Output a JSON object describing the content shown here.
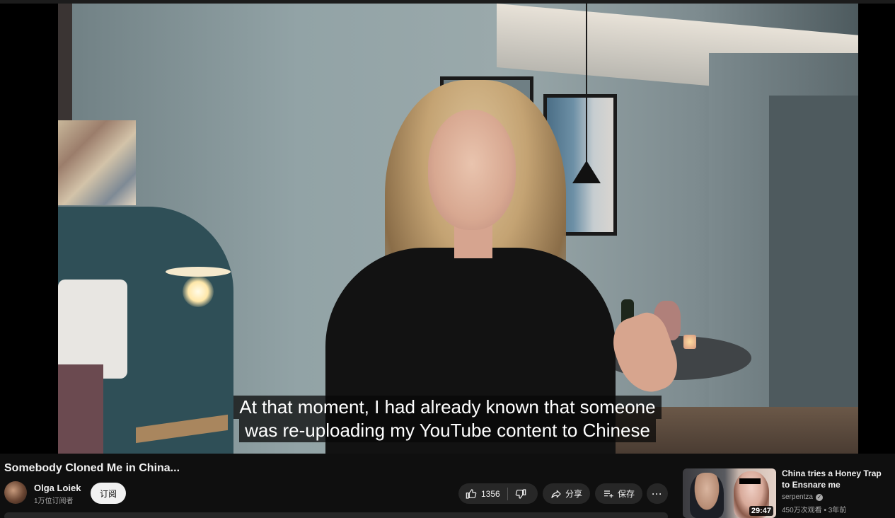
{
  "player": {
    "subtitles": [
      "At that moment, I had already known that someone",
      "was re-uploading my YouTube content to Chinese"
    ]
  },
  "video": {
    "title": "Somebody Cloned Me in China...",
    "channel_name": "Olga Loiek",
    "subscribers": "1万位订阅者",
    "subscribe_label": "订阅",
    "like_count": "1356",
    "share_label": "分享",
    "save_label": "保存",
    "more_label": "···"
  },
  "recommendation": {
    "title": "China tries a Honey Trap to Ensnare me",
    "channel": "serpentza",
    "views": "450万次观看",
    "age": "3年前",
    "duration": "29:47"
  },
  "icons": [
    "thumbs-up-icon",
    "thumbs-down-icon",
    "share-icon",
    "save-to-playlist-icon",
    "verified-badge-icon"
  ]
}
